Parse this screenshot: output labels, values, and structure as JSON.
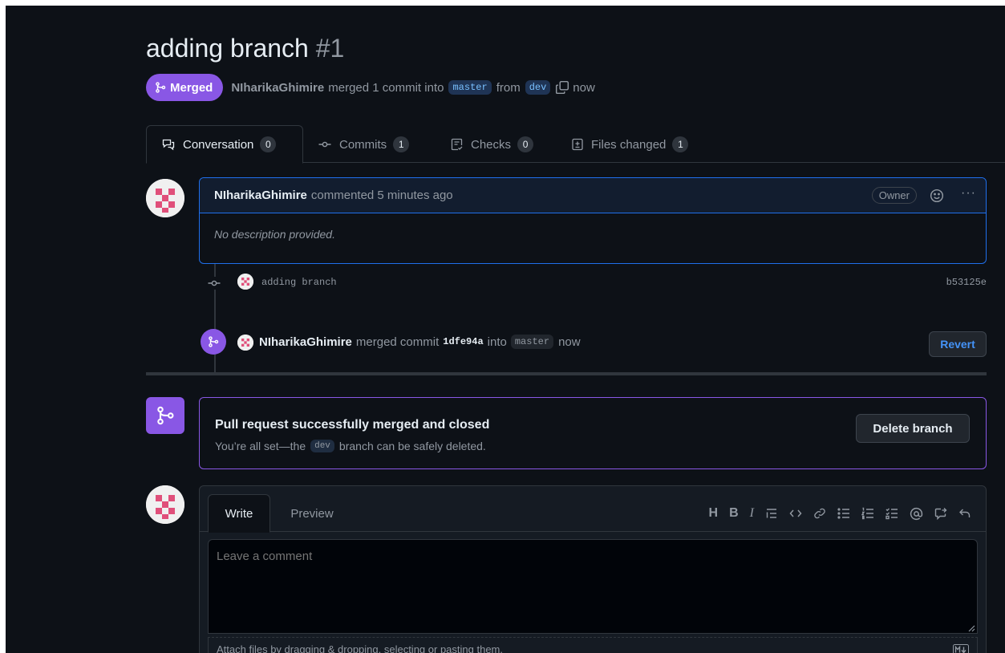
{
  "pr": {
    "title": "adding branch",
    "number": "#1",
    "state_label": "Merged",
    "author": "NIharikaGhimire",
    "summary_mid": "merged 1 commit into",
    "base_branch": "master",
    "from_word": "from",
    "head_branch": "dev",
    "time": "now"
  },
  "tabs": [
    {
      "label": "Conversation",
      "count": "0"
    },
    {
      "label": "Commits",
      "count": "1"
    },
    {
      "label": "Checks",
      "count": "0"
    },
    {
      "label": "Files changed",
      "count": "1"
    }
  ],
  "comment": {
    "author": "NIharikaGhimire",
    "action": "commented 5 minutes ago",
    "role_badge": "Owner",
    "body": "No description provided."
  },
  "commit_event": {
    "message": "adding branch",
    "sha": "b53125e"
  },
  "merge_event": {
    "author": "NIharikaGhimire",
    "action": "merged commit",
    "sha": "1dfe94a",
    "into_word": "into",
    "branch": "master",
    "time": "now",
    "revert_label": "Revert"
  },
  "merged_box": {
    "title": "Pull request successfully merged and closed",
    "desc_before": "You’re all set—the",
    "branch": "dev",
    "desc_after": "branch can be safely deleted.",
    "delete_label": "Delete branch"
  },
  "editor": {
    "write_tab": "Write",
    "preview_tab": "Preview",
    "placeholder": "Leave a comment",
    "attach_hint": "Attach files by dragging & dropping, selecting or pasting them.",
    "toolbar": {
      "heading": "H",
      "bold": "B",
      "italic": "I"
    }
  },
  "colors": {
    "background": "#0d1117",
    "merged_purple": "#8957e5",
    "accent_blue": "#2f81f7",
    "border": "#30363d"
  }
}
